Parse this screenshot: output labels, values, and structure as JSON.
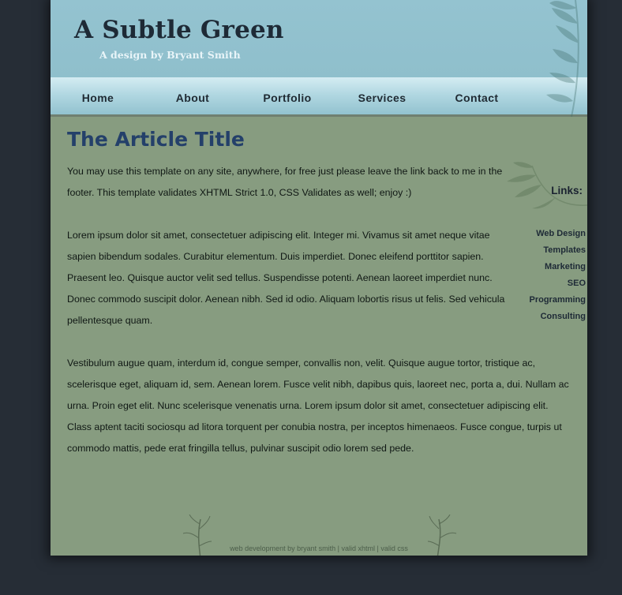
{
  "header": {
    "site_title": "A Subtle Green",
    "tagline": "A design by Bryant Smith"
  },
  "nav": {
    "items": [
      {
        "label": "Home"
      },
      {
        "label": "About"
      },
      {
        "label": "Portfolio"
      },
      {
        "label": "Services"
      },
      {
        "label": "Contact"
      }
    ]
  },
  "article": {
    "title": "The Article Title",
    "paragraphs": [
      "You may use this template on any site, anywhere, for free just please leave the link back to me in the footer. This template validates XHTML Strict 1.0, CSS Validates as well; enjoy :)",
      "Lorem ipsum dolor sit amet, consectetuer adipiscing elit. Integer mi. Vivamus sit amet neque vitae sapien bibendum sodales. Curabitur elementum. Duis imperdiet. Donec eleifend porttitor sapien. Praesent leo. Quisque auctor velit sed tellus. Suspendisse potenti. Aenean laoreet imperdiet nunc. Donec commodo suscipit dolor. Aenean nibh. Sed id odio. Aliquam lobortis risus ut felis. Sed vehicula pellentesque quam.",
      "Vestibulum augue quam, interdum id, congue semper, convallis non, velit. Quisque augue tortor, tristique ac, scelerisque eget, aliquam id, sem. Aenean lorem. Fusce velit nibh, dapibus quis, laoreet nec, porta a, dui. Nullam ac urna. Proin eget elit. Nunc scelerisque venenatis urna. Lorem ipsum dolor sit amet, consectetuer adipiscing elit. Class aptent taciti sociosqu ad litora torquent per conubia nostra, per inceptos himenaeos. Fusce congue, turpis ut commodo mattis, pede erat fringilla tellus, pulvinar suscipit odio lorem sed pede."
    ]
  },
  "sidebar": {
    "title": "Links:",
    "links": [
      "Web Design",
      "Templates",
      "Marketing",
      "SEO",
      "Programming",
      "Consulting"
    ]
  },
  "footer": {
    "credit": "web development by bryant smith",
    "separator": "|",
    "valid_xhtml": "valid xhtml",
    "valid_css": "valid css"
  },
  "colors": {
    "background": "#262d36",
    "content": "#879c80",
    "header": "#94c3d0",
    "title": "#24406a"
  },
  "icons": [
    "leaf-decoration-icon",
    "tree-icon"
  ]
}
